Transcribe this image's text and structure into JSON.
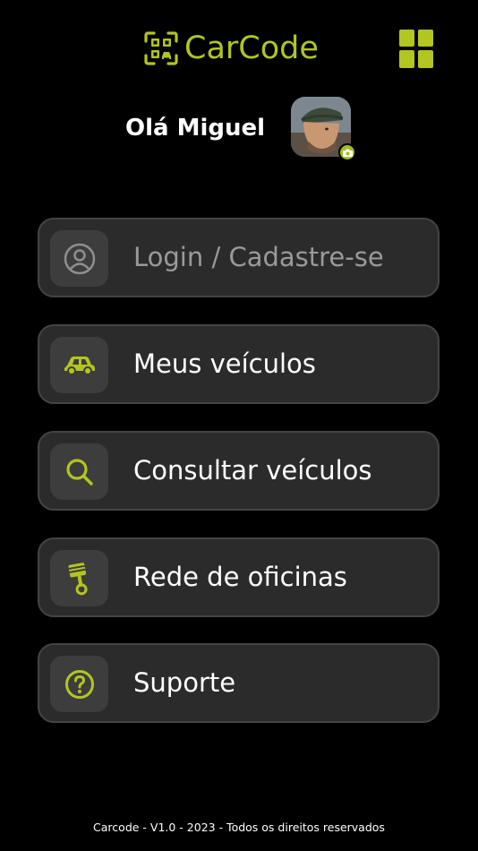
{
  "app": {
    "brand": "CarCode",
    "accent_color": "#b3c520"
  },
  "header": {
    "logo_icon": "qr-code-car-icon",
    "menu_icon": "grid-menu-icon"
  },
  "user": {
    "greeting": "Olá Miguel",
    "avatar_icon": "user-photo",
    "badge_icon": "camera-icon"
  },
  "menu": {
    "items": [
      {
        "label": "Login / Cadastre-se",
        "icon": "user-circle-icon",
        "muted": true
      },
      {
        "label": "Meus veículos",
        "icon": "car-icon"
      },
      {
        "label": "Consultar veículos",
        "icon": "search-icon"
      },
      {
        "label": "Rede de oficinas",
        "icon": "workshop-piston-icon"
      },
      {
        "label": "Suporte",
        "icon": "help-circle-icon"
      }
    ]
  },
  "footer": {
    "text": "Carcode - V1.0 - 2023 - Todos os direitos reservados"
  }
}
